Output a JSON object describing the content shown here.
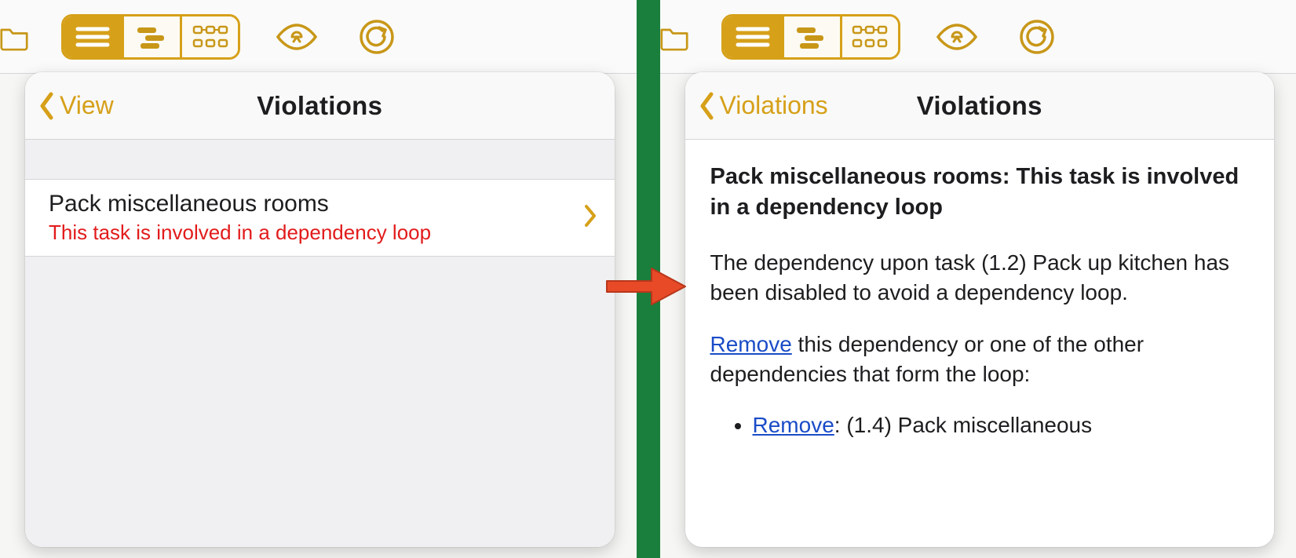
{
  "toolbar": {
    "items": [
      "folder",
      "view-segmented",
      "inspector",
      "undo"
    ]
  },
  "left_pane": {
    "back_label": "View",
    "title": "Violations",
    "rows": [
      {
        "title": "Pack miscellaneous rooms",
        "subtitle": "This task is involved in a dependency loop"
      }
    ]
  },
  "right_pane": {
    "back_label": "Violations",
    "title": "Violations",
    "heading": "Pack miscellaneous rooms: This task is involved in a dependency loop",
    "paragraph1": "The dependency upon task (1.2) Pack up kitchen has been disabled to avoid a dependency loop.",
    "remove_link": "Remove",
    "paragraph2_tail": " this dependency or one of the other dependencies that form the loop:",
    "bullet_remove_link": "Remove",
    "bullet_tail": ": (1.4) Pack miscellaneous"
  }
}
